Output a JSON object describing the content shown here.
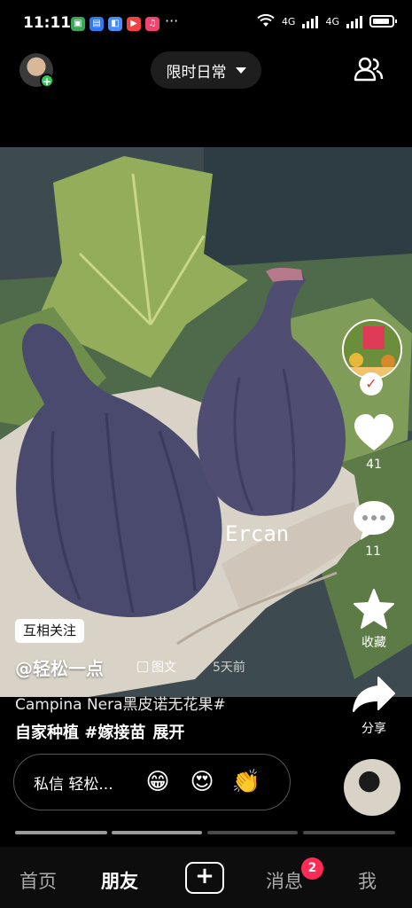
{
  "status_bar": {
    "time": "11:11",
    "more": "···",
    "network1": "4G",
    "network2": "4G",
    "apps": [
      {
        "icon": "app-icon-1",
        "color": "#3aa757",
        "glyph": "▣"
      },
      {
        "icon": "app-icon-2",
        "color": "#2f7bf5",
        "glyph": "▤"
      },
      {
        "icon": "app-icon-3",
        "color": "#4a8df7",
        "glyph": "◧"
      },
      {
        "icon": "video-app-icon",
        "color": "#ef4444",
        "glyph": "▶"
      },
      {
        "icon": "music-app-icon",
        "color": "#f0436e",
        "glyph": "♫"
      }
    ]
  },
  "header": {
    "channel": "限时日常"
  },
  "post": {
    "watermark": "Ercan",
    "tag": "互相关注",
    "author": "@轻松一点",
    "type": "图文",
    "time_ago": "5天前",
    "caption_line1": "Campina Nera黑皮诺无花果#",
    "caption_line2": "自家种植 #嫁接苗",
    "expand": "展开"
  },
  "rail": {
    "likes": "41",
    "comments": "11",
    "favorite_label": "收藏",
    "share_label": "分享"
  },
  "message_bar": {
    "label": "私信 轻松...",
    "emojis": [
      "😁",
      "😍",
      "👏"
    ]
  },
  "progress": {
    "total_segments": 4,
    "current_index": 1
  },
  "nav": {
    "home": "首页",
    "friends": "朋友",
    "messages": "消息",
    "messages_badge": "2",
    "me": "我"
  },
  "colors": {
    "accent": "#fe2c55",
    "background": "#000000"
  }
}
